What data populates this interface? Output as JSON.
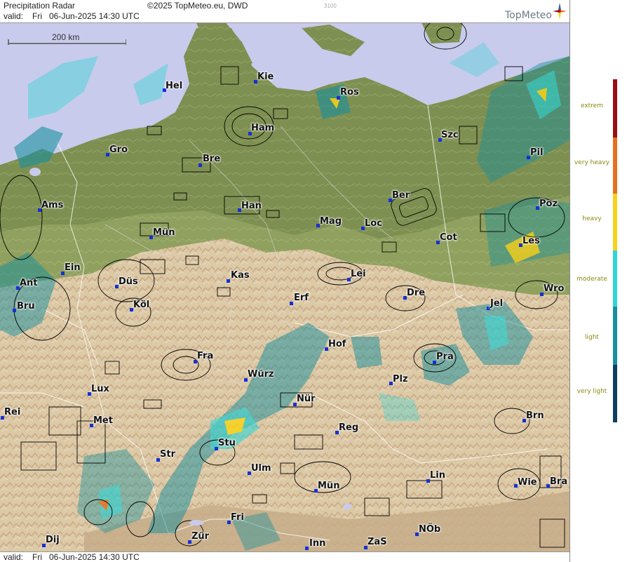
{
  "header": {
    "title": "Precipitation Radar",
    "copyright": "©2025 TopMeteo.eu, DWD",
    "small_code": "3100",
    "valid_label": "valid:",
    "valid_time": "Fri   06-Jun-2025 14:30 UTC",
    "logo": "TopMeteo"
  },
  "footer": {
    "valid_label": "valid:",
    "valid_time": "Fri   06-Jun-2025 14:30 UTC"
  },
  "scale": {
    "label": "200 km"
  },
  "legend": {
    "items": [
      {
        "label": "extrem",
        "color": "#9a0f12"
      },
      {
        "label": "very heavy",
        "color": "#e8701c"
      },
      {
        "label": "heavy",
        "color": "#f7d21a"
      },
      {
        "label": "moderate",
        "color": "#2fd6d6"
      },
      {
        "label": "light",
        "color": "#17909c"
      },
      {
        "label": "very light",
        "color": "#0e3f5c"
      }
    ]
  },
  "cities": [
    {
      "name": "Hel"
    },
    {
      "name": "Kie"
    },
    {
      "name": "Ros"
    },
    {
      "name": "Ham"
    },
    {
      "name": "Szc"
    },
    {
      "name": "Gro"
    },
    {
      "name": "Bre"
    },
    {
      "name": "Pil"
    },
    {
      "name": "Ams"
    },
    {
      "name": "Han"
    },
    {
      "name": "Ber"
    },
    {
      "name": "Poz"
    },
    {
      "name": "Mün"
    },
    {
      "name": "Mag"
    },
    {
      "name": "Loc"
    },
    {
      "name": "Cot"
    },
    {
      "name": "Les"
    },
    {
      "name": "Ein"
    },
    {
      "name": "Kas"
    },
    {
      "name": "Lei"
    },
    {
      "name": "Ant"
    },
    {
      "name": "Düs"
    },
    {
      "name": "Dre"
    },
    {
      "name": "Wro"
    },
    {
      "name": "Bru"
    },
    {
      "name": "Köl"
    },
    {
      "name": "Erf"
    },
    {
      "name": "Jel"
    },
    {
      "name": "Hof"
    },
    {
      "name": "Fra"
    },
    {
      "name": "Pra"
    },
    {
      "name": "Würz"
    },
    {
      "name": "Plz"
    },
    {
      "name": "Lux"
    },
    {
      "name": "Nür"
    },
    {
      "name": "Rei"
    },
    {
      "name": "Met"
    },
    {
      "name": "Reg"
    },
    {
      "name": "Brn"
    },
    {
      "name": "Stu"
    },
    {
      "name": "Str"
    },
    {
      "name": "Ulm"
    },
    {
      "name": "Lin"
    },
    {
      "name": "Mün"
    },
    {
      "name": "Wie"
    },
    {
      "name": "Bra"
    },
    {
      "name": "Fri"
    },
    {
      "name": "Zür"
    },
    {
      "name": "NÖb"
    },
    {
      "name": "Dij"
    },
    {
      "name": "Inn"
    },
    {
      "name": "ZaS"
    }
  ],
  "colors": {
    "sea": "#c9cbec",
    "lowland": "#8c9d5e",
    "upland": "#d9c9a8",
    "dot": "#1530d8"
  }
}
